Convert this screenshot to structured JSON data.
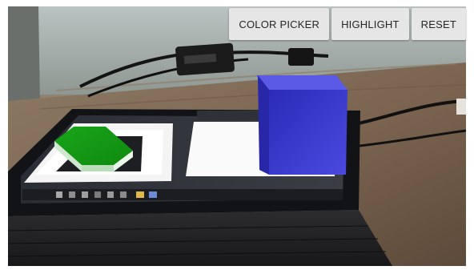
{
  "toolbar": {
    "color_picker_label": "COLOR PICKER",
    "highlight_label": "HIGHLIGHT",
    "reset_label": "RESET"
  },
  "scene": {
    "description": "AR camera view of a tablet on a desk with two virtual 3D objects",
    "objects": [
      {
        "name": "green-hexagonal-prism",
        "color": "#179b17"
      },
      {
        "name": "blue-cube",
        "color": "#3434cc"
      }
    ]
  },
  "colors": {
    "button_bg": "#e6e6e6",
    "button_text": "#262626"
  }
}
